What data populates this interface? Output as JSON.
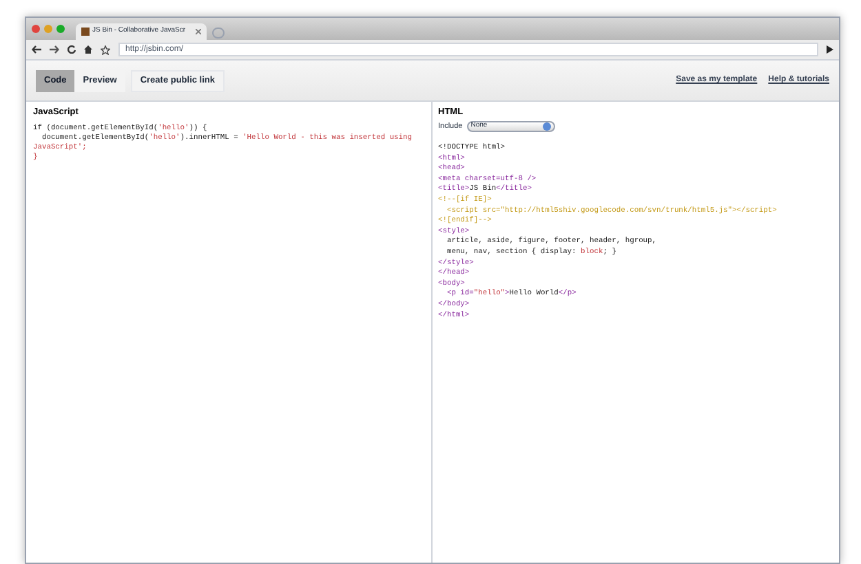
{
  "browser": {
    "tab_title": "JS Bin - Collaborative JavaScr",
    "url": "http://jsbin.com/"
  },
  "toolbar": {
    "tabs": [
      {
        "label": "Code",
        "selected": true
      },
      {
        "label": "Preview",
        "selected": false
      }
    ],
    "public_link": "Create public link",
    "links": [
      "Save as my template",
      "Help & tutorials"
    ]
  },
  "javascript_panel": {
    "title": "JavaScript",
    "lines": [
      [
        {
          "kind": "plain",
          "text": "if (document.getElementById("
        },
        {
          "kind": "string",
          "text": "'hello'"
        },
        {
          "kind": "plain",
          "text": ")) {"
        }
      ],
      [
        {
          "kind": "plain",
          "text": "  document.getElementById("
        },
        {
          "kind": "string",
          "text": "'hello'"
        },
        {
          "kind": "plain",
          "text": ").innerHTML = "
        },
        {
          "kind": "string",
          "text": "'Hello World - this was inserted using"
        }
      ],
      [
        {
          "kind": "string",
          "text": "JavaScript';"
        }
      ],
      [
        {
          "kind": "string",
          "text": "}"
        }
      ]
    ]
  },
  "html_panel": {
    "title": "HTML",
    "include_label": "Include",
    "include_value": "None",
    "lines": [
      [
        {
          "kind": "plain",
          "text": "<!DOCTYPE html>"
        }
      ],
      [
        {
          "kind": "tag",
          "text": "<html>"
        }
      ],
      [
        {
          "kind": "tag",
          "text": "<head>"
        }
      ],
      [
        {
          "kind": "tag",
          "text": "<meta charset=utf-8 />"
        }
      ],
      [
        {
          "kind": "tag",
          "text": "<title>"
        },
        {
          "kind": "plain",
          "text": "JS Bin"
        },
        {
          "kind": "tag",
          "text": "</title>"
        }
      ],
      [
        {
          "kind": "comment",
          "text": "<!--[if IE]>"
        }
      ],
      [
        {
          "kind": "comment",
          "text": "  <script src=\"http://html5shiv.googlecode.com/svn/trunk/html5.js\"></script>"
        }
      ],
      [
        {
          "kind": "comment",
          "text": "<![endif]-->"
        }
      ],
      [
        {
          "kind": "tag",
          "text": "<style>"
        }
      ],
      [
        {
          "kind": "plain",
          "text": "  article, aside, figure, footer, header, hgroup,"
        }
      ],
      [
        {
          "kind": "plain",
          "text": "  menu, nav, section { display: "
        },
        {
          "kind": "string",
          "text": "block"
        },
        {
          "kind": "plain",
          "text": "; }"
        }
      ],
      [
        {
          "kind": "tag",
          "text": "</style>"
        }
      ],
      [
        {
          "kind": "tag",
          "text": "</head>"
        }
      ],
      [
        {
          "kind": "tag",
          "text": "<body>"
        }
      ],
      [
        {
          "kind": "tag",
          "text": "  <p id="
        },
        {
          "kind": "string",
          "text": "\"hello\""
        },
        {
          "kind": "tag",
          "text": ">"
        },
        {
          "kind": "plain",
          "text": "Hello World"
        },
        {
          "kind": "tag",
          "text": "</p>"
        }
      ],
      [
        {
          "kind": "tag",
          "text": "</body>"
        }
      ],
      [
        {
          "kind": "tag",
          "text": "</html>"
        }
      ]
    ]
  }
}
